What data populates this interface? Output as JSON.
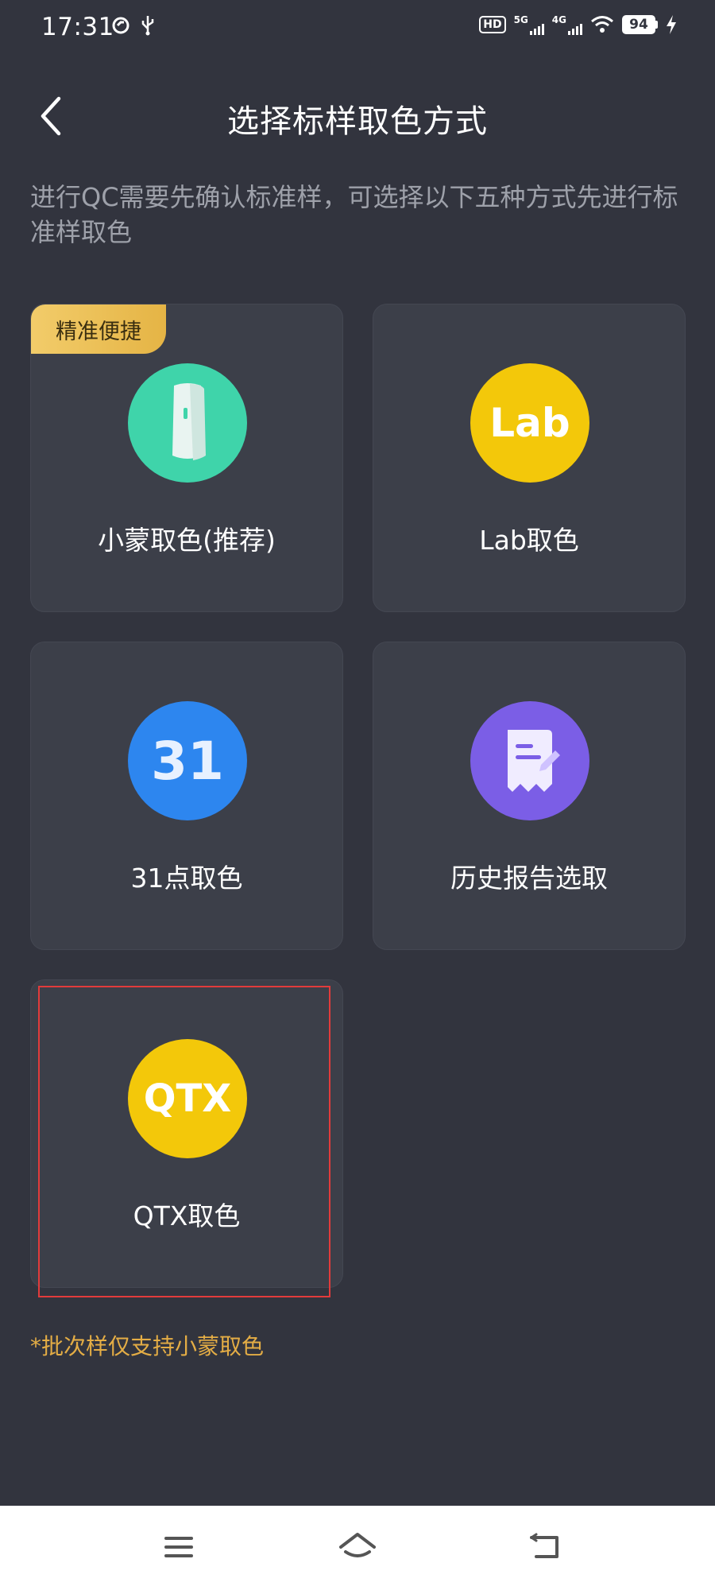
{
  "status": {
    "time": "17:31",
    "hd_label": "HD",
    "net1": "5G",
    "net2": "4G",
    "battery": "94"
  },
  "header": {
    "title": "选择标样取色方式"
  },
  "intro": "进行QC需要先确认标准样，可选择以下五种方式先进行标准样取色",
  "cards": [
    {
      "label": "小蒙取色(推荐)",
      "badge": "精准便捷",
      "icon": "device-icon",
      "color": "#3fd4aa"
    },
    {
      "label": "Lab取色",
      "icon_text": "Lab",
      "icon": "lab-icon",
      "color": "#f3c80a"
    },
    {
      "label": "31点取色",
      "icon_text": "31",
      "icon": "thirty-one-icon",
      "color": "#2d86ef"
    },
    {
      "label": "历史报告选取",
      "icon": "report-icon",
      "color": "#7b5ee6"
    },
    {
      "label": "QTX取色",
      "icon_text": "QTX",
      "icon": "qtx-icon",
      "color": "#f3c80a"
    }
  ],
  "footnote": "*批次样仅支持小蒙取色",
  "colors": {
    "background": "#32343e",
    "card": "#3c3f49",
    "accent": "#e4ad45",
    "highlight": "#e23b3b"
  }
}
